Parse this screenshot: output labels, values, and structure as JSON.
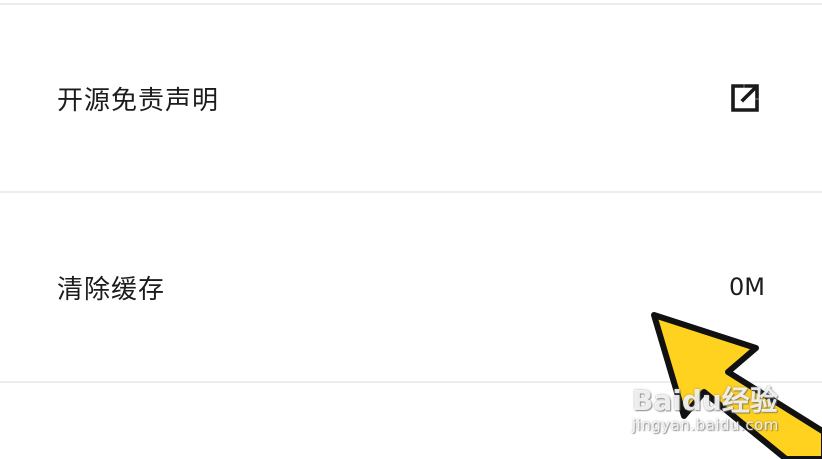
{
  "settings": {
    "items": [
      {
        "label": "开源免责声明",
        "trailing_icon": "external-link-icon"
      },
      {
        "label": "清除缓存",
        "value": "0M"
      }
    ]
  },
  "overlay": {
    "arrow_color": "#ffd21f",
    "arrow_outline_color": "#111111"
  },
  "watermark": {
    "brand": "Baidu经验",
    "url": "jingyan.baidu.com"
  }
}
